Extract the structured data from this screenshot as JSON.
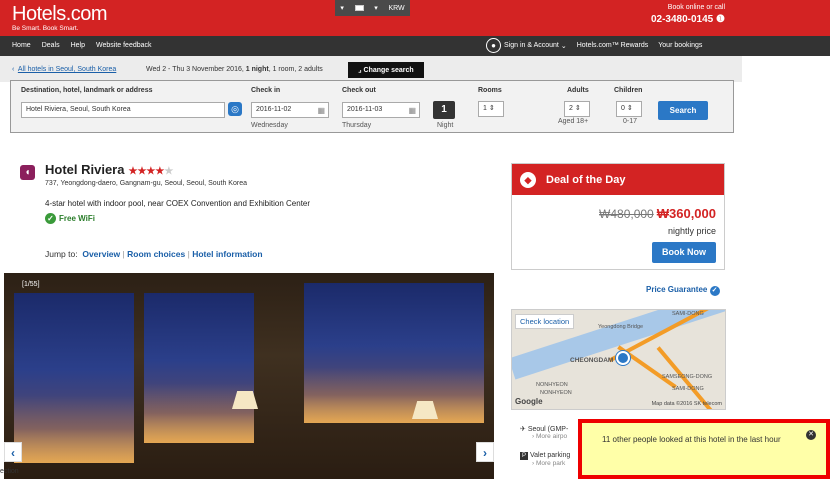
{
  "header": {
    "brand": "Hotels.com",
    "tagline": "Be Smart. Book Smart.",
    "locale_currency": "KRW",
    "book_online": "Book online or call",
    "phone": "02-3480-0145"
  },
  "nav": {
    "left": [
      "Home",
      "Deals",
      "Help",
      "Website feedback"
    ],
    "sign_in": "Sign in & Account",
    "rewards": "Hotels.com™ Rewards",
    "bookings": "Your bookings"
  },
  "search_bar": {
    "breadcrumb": "All hotels in Seoul, South Korea",
    "dates_prefix": "Wed 2 - Thu 3 November 2016,",
    "nights_bold": "1 night",
    "dates_suffix": ", 1 room, 2 adults",
    "change_search": "Change search"
  },
  "form": {
    "destination_label": "Destination, hotel, landmark or address",
    "destination_value": "Hotel Riviera, Seoul, South Korea",
    "checkin_label": "Check in",
    "checkin_value": "2016-11-02",
    "checkin_day": "Wednesday",
    "checkout_label": "Check out",
    "checkout_value": "2016-11-03",
    "checkout_day": "Thursday",
    "nights": "1",
    "nights_label": "Night",
    "rooms_label": "Rooms",
    "rooms_value": "1",
    "adults_label": "Adults",
    "adults_value": "2",
    "adults_sub": "Aged 18+",
    "children_label": "Children",
    "children_value": "0",
    "children_sub": "0-17",
    "search_button": "Search"
  },
  "hotel": {
    "name": "Hotel Riviera",
    "stars_on": "★★★★",
    "stars_off": "★",
    "address": "737, Yeongdong-daero, Gangnam-gu, Seoul, Seoul, South Korea",
    "description": "4-star hotel with indoor pool, near COEX Convention and Exhibition Center",
    "amenity": "Free WiFi",
    "jump_label": "Jump to:",
    "jump_links": [
      "Overview",
      "Room choices",
      "Hotel information"
    ],
    "photo_counter": "[1/55]"
  },
  "deal": {
    "title": "Deal of the Day",
    "old_price": "₩480,000",
    "new_price": "₩360,000",
    "nightly": "nightly price",
    "book_now": "Book Now",
    "price_guarantee": "Price Guarantee"
  },
  "map": {
    "check_location": "Check location",
    "labels": [
      "Yeongdong Bridge",
      "CHEONGDAM",
      "NONHYEON",
      "SAMI-DONG",
      "SAMSEONG-DONG",
      "SAMI-DONG",
      "NONHYEON"
    ],
    "google": "Google",
    "data": "Map data ©2016 SK telecom"
  },
  "info_items": [
    {
      "title": "Seoul (GMP-",
      "sub": "More airpo"
    },
    {
      "title": "Valet parking",
      "sub": "More park"
    }
  ],
  "popup": {
    "message": "11 other people looked at this hotel in the last hour"
  },
  "cut_text": "ection"
}
